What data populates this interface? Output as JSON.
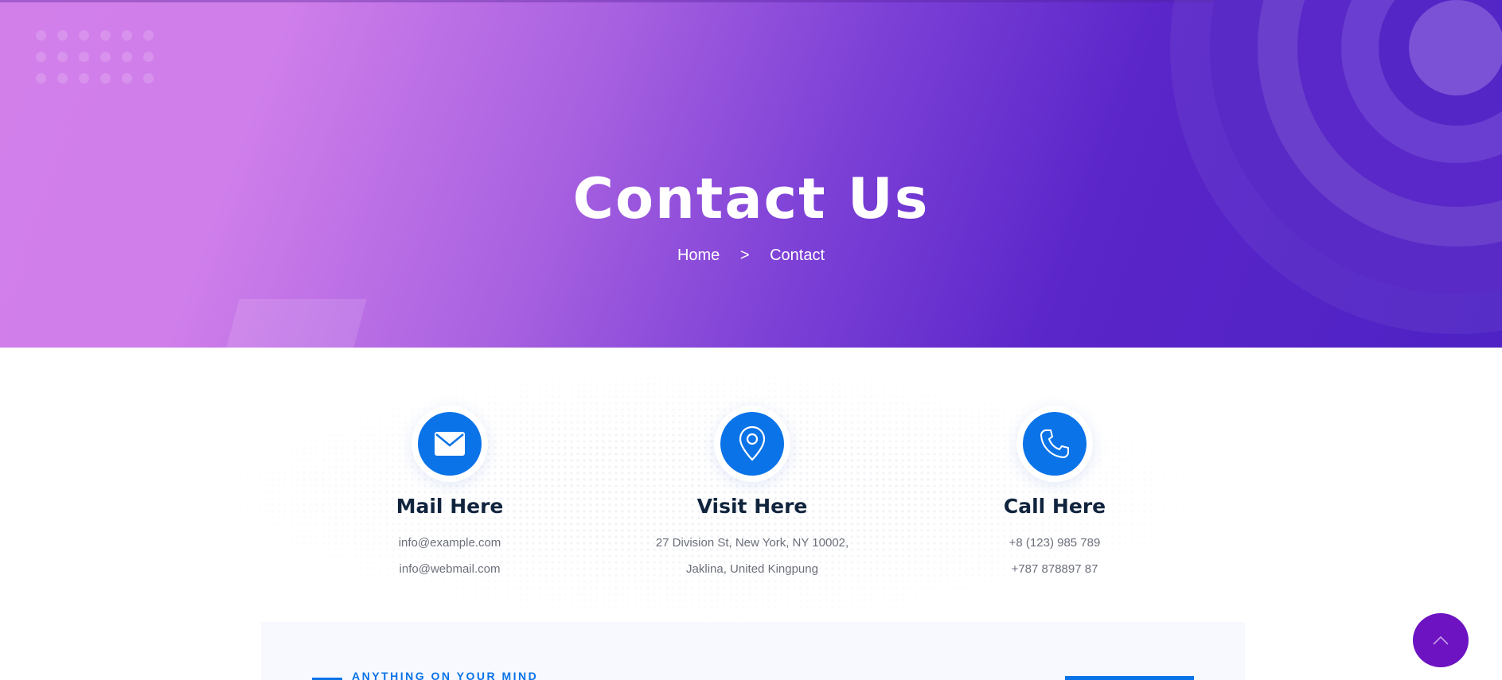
{
  "hero": {
    "title": "Contact Us",
    "breadcrumb": {
      "home": "Home",
      "separator": ">",
      "current": "Contact"
    }
  },
  "cards": [
    {
      "icon": "envelope-icon",
      "title": "Mail Here",
      "lines": [
        "info@example.com",
        "info@webmail.com"
      ]
    },
    {
      "icon": "map-pin-icon",
      "title": "Visit Here",
      "lines": [
        "27 Division St, New York, NY 10002,",
        "Jaklina, United Kingpung"
      ]
    },
    {
      "icon": "phone-icon",
      "title": "Call Here",
      "lines": [
        "+8 (123) 985 789",
        "+787 878897 87"
      ]
    }
  ],
  "form": {
    "tagline": "ANYTHING ON YOUR MIND"
  },
  "scroll_top": {
    "icon": "chevron-up-icon"
  },
  "colors": {
    "accent": "#0a73e8",
    "heading": "#11243e",
    "scroll_button": "#6d13c2",
    "hero_start": "#d27fea",
    "hero_end": "#4e22c4"
  }
}
